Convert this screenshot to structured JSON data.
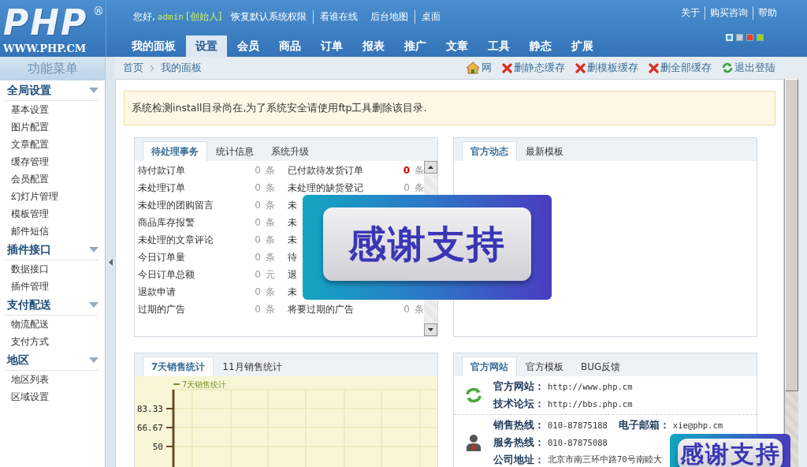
{
  "header": {
    "logo": {
      "mark": "PHP",
      "registered": "®",
      "site": "WWW.PHP.CM"
    },
    "greeting": "您好,",
    "user": "admin",
    "role": "[创始人]",
    "links": [
      {
        "label": "恢复默认系统权限",
        "divider_after": true
      },
      {
        "label": "看谁在线",
        "divider_after": false
      },
      {
        "label": "后台地图",
        "divider_after": true
      },
      {
        "label": "桌面",
        "divider_after": false
      }
    ],
    "right_links": [
      "关于",
      "购买咨询",
      "帮助"
    ],
    "nav": [
      {
        "label": "我的面板",
        "selected": false
      },
      {
        "label": "设置",
        "selected": true
      },
      {
        "label": "会员",
        "selected": false
      },
      {
        "label": "商品",
        "selected": false
      },
      {
        "label": "订单",
        "selected": false
      },
      {
        "label": "报表",
        "selected": false
      },
      {
        "label": "推广",
        "selected": false
      },
      {
        "label": "文章",
        "selected": false
      },
      {
        "label": "工具",
        "selected": false
      },
      {
        "label": "静态",
        "selected": false
      },
      {
        "label": "扩展",
        "selected": false
      }
    ],
    "theme_swatches": [
      {
        "color": "#3fa0d8",
        "selected": true
      },
      {
        "color": "#c8ccd0",
        "selected": false
      },
      {
        "color": "#e8401a",
        "selected": false
      },
      {
        "color": "#98d020",
        "selected": false
      }
    ]
  },
  "sidebar": {
    "title": "功能菜单",
    "groups": [
      {
        "label": "全局设置",
        "expanded": true,
        "items": [
          "基本设置",
          "图片配置",
          "文章配置",
          "缓存管理",
          "会员配置",
          "幻灯片管理",
          "模板管理",
          "邮件短信"
        ]
      },
      {
        "label": "插件接口",
        "expanded": true,
        "items": [
          "数据接口",
          "插件管理"
        ]
      },
      {
        "label": "支付配送",
        "expanded": true,
        "items": [
          "物流配送",
          "支付方式"
        ]
      },
      {
        "label": "地区",
        "expanded": true,
        "items": [
          "地区列表",
          "区域设置"
        ]
      }
    ]
  },
  "breadcrumb": [
    "首页",
    "我的面板"
  ],
  "actions": [
    {
      "kind": "home",
      "label": "网"
    },
    {
      "kind": "delete",
      "label": "删静态缓存"
    },
    {
      "kind": "delete",
      "label": "删模板缓存"
    },
    {
      "kind": "delete",
      "label": "删全部缓存"
    },
    {
      "kind": "logout",
      "label": "退出登陆"
    }
  ],
  "notice": "系统检测install目录尚在,为了系统安全请使用ftp工具删除该目录.",
  "pending_panel": {
    "tabs": [
      {
        "label": "待处理事务",
        "selected": true
      },
      {
        "label": "统计信息",
        "selected": false
      },
      {
        "label": "系统升级",
        "selected": false
      }
    ],
    "rows": [
      {
        "left": {
          "label": "待付款订单",
          "count": "0",
          "unit": "条"
        },
        "right": {
          "label": "已付款待发货订单",
          "count": "0",
          "unit": "条",
          "alert": true
        }
      },
      {
        "left": {
          "label": "未处理订单",
          "count": "0",
          "unit": "条"
        },
        "right": {
          "label": "未处理的缺货登记",
          "count": "0",
          "unit": "条",
          "alert": false
        }
      },
      {
        "left": {
          "label": "未处理的团购留言",
          "count": "0",
          "unit": "条"
        },
        "right": {
          "label": "未"
        }
      },
      {
        "left": {
          "label": "商品库存报警",
          "count": "0",
          "unit": "条"
        },
        "right": {
          "label": "未"
        }
      },
      {
        "left": {
          "label": "未处理的文章评论",
          "count": "0",
          "unit": "条"
        },
        "right": {
          "label": "未"
        }
      },
      {
        "left": {
          "label": "今日订单量",
          "count": "0",
          "unit": "条"
        },
        "right": {
          "label": "待"
        }
      },
      {
        "left": {
          "label": "今日订单总额",
          "count": "0",
          "unit": "元"
        },
        "right": {
          "label": "退"
        }
      },
      {
        "left": {
          "label": "退款申请",
          "count": "0",
          "unit": "条"
        },
        "right": {
          "label": "未"
        }
      },
      {
        "left": {
          "label": "过期的广告",
          "count": "0",
          "unit": "条"
        },
        "right": {
          "label": "将要过期的广告",
          "count": "0",
          "unit": "条",
          "alert": false
        }
      }
    ]
  },
  "news_panel": {
    "tabs": [
      {
        "label": "官方动态",
        "selected": true
      },
      {
        "label": "最新模板",
        "selected": false
      }
    ]
  },
  "sales_panel": {
    "tabs": [
      {
        "label": "7天销售统计",
        "selected": true
      },
      {
        "label": "11月销售统计",
        "selected": false
      }
    ],
    "chart_data": {
      "type": "line",
      "grid": true,
      "ylim": [
        21.53,
        100
      ],
      "yticks": [
        {
          "value": 50,
          "label": "50"
        },
        {
          "value": 66.67,
          "label": "66.67"
        },
        {
          "value": 83.33,
          "label": "83.33"
        }
      ],
      "series": [
        {
          "name": "7天销售统计",
          "color": "#7a8a20"
        }
      ]
    }
  },
  "official_panel": {
    "tabs": [
      {
        "label": "官方网站",
        "selected": true
      },
      {
        "label": "官方模板",
        "selected": false
      },
      {
        "label": "BUG反馈",
        "selected": false
      }
    ],
    "sections": [
      {
        "kind": "links",
        "lines": [
          [
            {
              "label": "官方网站：",
              "value": "http://www.php.cm"
            }
          ],
          [
            {
              "label": "技术论坛：",
              "value": "http://bbs.php.cm"
            }
          ]
        ]
      },
      {
        "kind": "contact",
        "lines": [
          [
            {
              "label": "销售热线：",
              "value": "010-87875188"
            },
            {
              "label": "电子邮箱：",
              "value": "xie@php.cm"
            }
          ],
          [
            {
              "label": "服务热线：",
              "value": "010-87875088"
            }
          ],
          [
            {
              "label": "公司地址：",
              "value": "北京市南三环中路70号南睦大"
            }
          ]
        ]
      }
    ]
  },
  "overlays": [
    {
      "text": "感谢支持"
    },
    {
      "text": "感谢支持"
    }
  ]
}
